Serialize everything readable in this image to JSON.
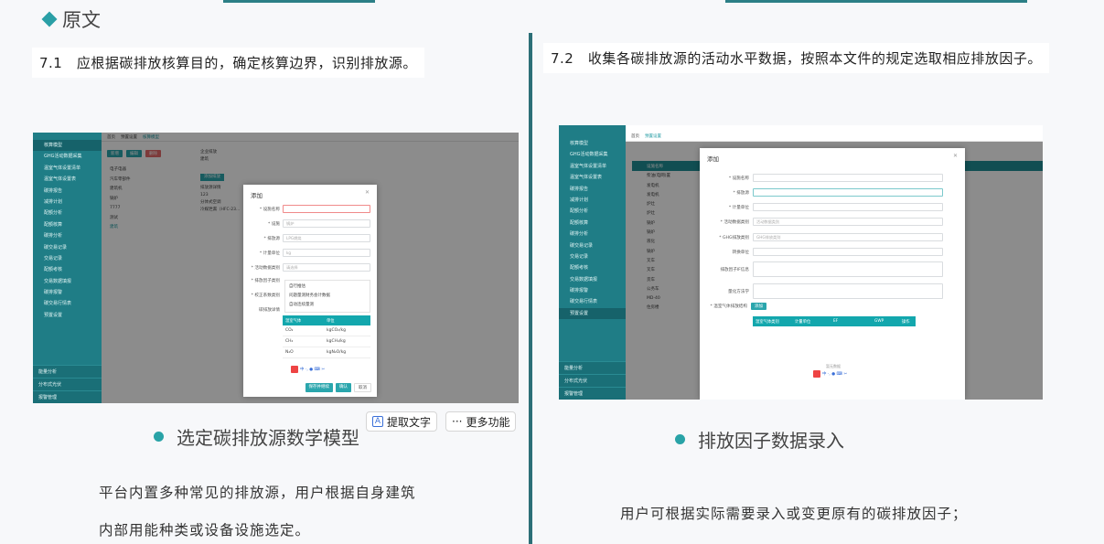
{
  "page": {
    "heading": "原文",
    "clause_left": "7.1　应根据碳排放核算目的，确定核算边界，识别排放源。",
    "clause_right": "7.2　收集各碳排放源的活动水平数据，按照本文件的规定选取相应排放因子。",
    "caption_left": "选定碳排放源数学模型",
    "caption_right": "排放因子数据录入",
    "para_left_1": "平台内置多种常见的排放源，用户根据自身建筑",
    "para_left_2": "内部用能种类或设备设施选定。",
    "para_right": "用户可根据实际需要录入或变更原有的碳排放因子；"
  },
  "floating_toolbar": {
    "extract_text": "提取文字",
    "more": "更多功能"
  },
  "left_shot": {
    "breadcrumb": [
      "首页",
      "预置设置",
      "核算模型"
    ],
    "sidebar_items": [
      "核算模型",
      "GHG活动数据采集",
      "温室气体设置清单",
      "温室气体设置表",
      "碳排报告",
      "减排计划",
      "配额分析",
      "配额核算",
      "碳排分析",
      "碳交易记录",
      "交易记录",
      "配额考核",
      "交易数据填报",
      "碳排报警",
      "碳交易行情表",
      "预置设置"
    ],
    "sidebar_groups": [
      "能量分析",
      "分布式光伏",
      "报警管理"
    ],
    "toolbar": [
      "新增",
      "编辑",
      "删除"
    ],
    "tree_items": [
      "电子电器",
      "汽车零部件",
      "建筑机",
      "锅炉",
      "7777",
      "测试",
      "建筑"
    ],
    "right_panel": [
      "企业排放",
      "建筑",
      "添加排放",
      "排放源详情",
      "123",
      "分体式空调",
      "冷媒泄漏（HFC-23..."
    ],
    "dialog": {
      "title": "添加",
      "fields": [
        {
          "label": "* 设施名称",
          "value": ""
        },
        {
          "label": "* 设施",
          "value": "锅炉"
        },
        {
          "label": "* 排放源",
          "value": "LPG燃烧"
        },
        {
          "label": "* 计量单位",
          "value": "kg"
        },
        {
          "label": "* 活动数据类别",
          "value": "请选择"
        },
        {
          "label": "* 排放因子类别",
          "value": ""
        },
        {
          "label": "* 校正系数类别",
          "value": ""
        },
        {
          "label": "碳排放详情",
          "value": ""
        }
      ],
      "dropdown": [
        "自行推估",
        "问题量测财务会计数据",
        "自动连续量测"
      ],
      "table_header": [
        "温室气体",
        "单位"
      ],
      "table_rows": [
        [
          "CO₂",
          "kgCO₂/kg"
        ],
        [
          "CH₄",
          "kgCH₄/kg"
        ],
        [
          "N₂O",
          "kgN₂O/kg"
        ]
      ],
      "buttons": [
        "保存并继续",
        "确认",
        "取消"
      ]
    }
  },
  "right_shot": {
    "breadcrumb": [
      "首页",
      "预置设置"
    ],
    "sidebar_items": [
      "核算模型",
      "GHG活动数据采集",
      "温室气体设置清单",
      "温室气体设置表",
      "碳排报告",
      "减排计划",
      "配额分析",
      "配额核算",
      "碳排分析",
      "碳交易记录",
      "交易记录",
      "配额考核",
      "交易数据填报",
      "碳排报警",
      "碳交易行情表",
      "预置设置"
    ],
    "sidebar_groups": [
      "能量分析",
      "分布式光伏",
      "报警管理"
    ],
    "list_items": [
      "设施名称",
      "柴油(电网)置",
      "发电机",
      "发电机",
      "炉灶",
      "炉灶",
      "锅炉",
      "锅炉",
      "液化",
      "锅炉",
      "叉车",
      "叉车",
      "货车",
      "公务车",
      "MD-40",
      "住房楼"
    ],
    "dialog": {
      "title": "添加",
      "fields": [
        {
          "label": "* 设施名称",
          "value": ""
        },
        {
          "label": "* 排放源",
          "value": ""
        },
        {
          "label": "* 计量单位",
          "value": ""
        },
        {
          "label": "* 活动数据类别",
          "value": "活动数据类别"
        },
        {
          "label": "* GHG排放类别",
          "value": "GHG排放类别"
        },
        {
          "label": "转换单位",
          "value": ""
        },
        {
          "label": "排放因子IF信息",
          "value": ""
        },
        {
          "label": "量化方法学",
          "value": ""
        }
      ],
      "ghg_label": "* 温室气体排放结构",
      "add_button": "添加",
      "table_header": [
        "温室气体类别",
        "计量单位",
        "EF",
        "GWP",
        "操作"
      ],
      "empty_text": "暂无数据"
    }
  }
}
